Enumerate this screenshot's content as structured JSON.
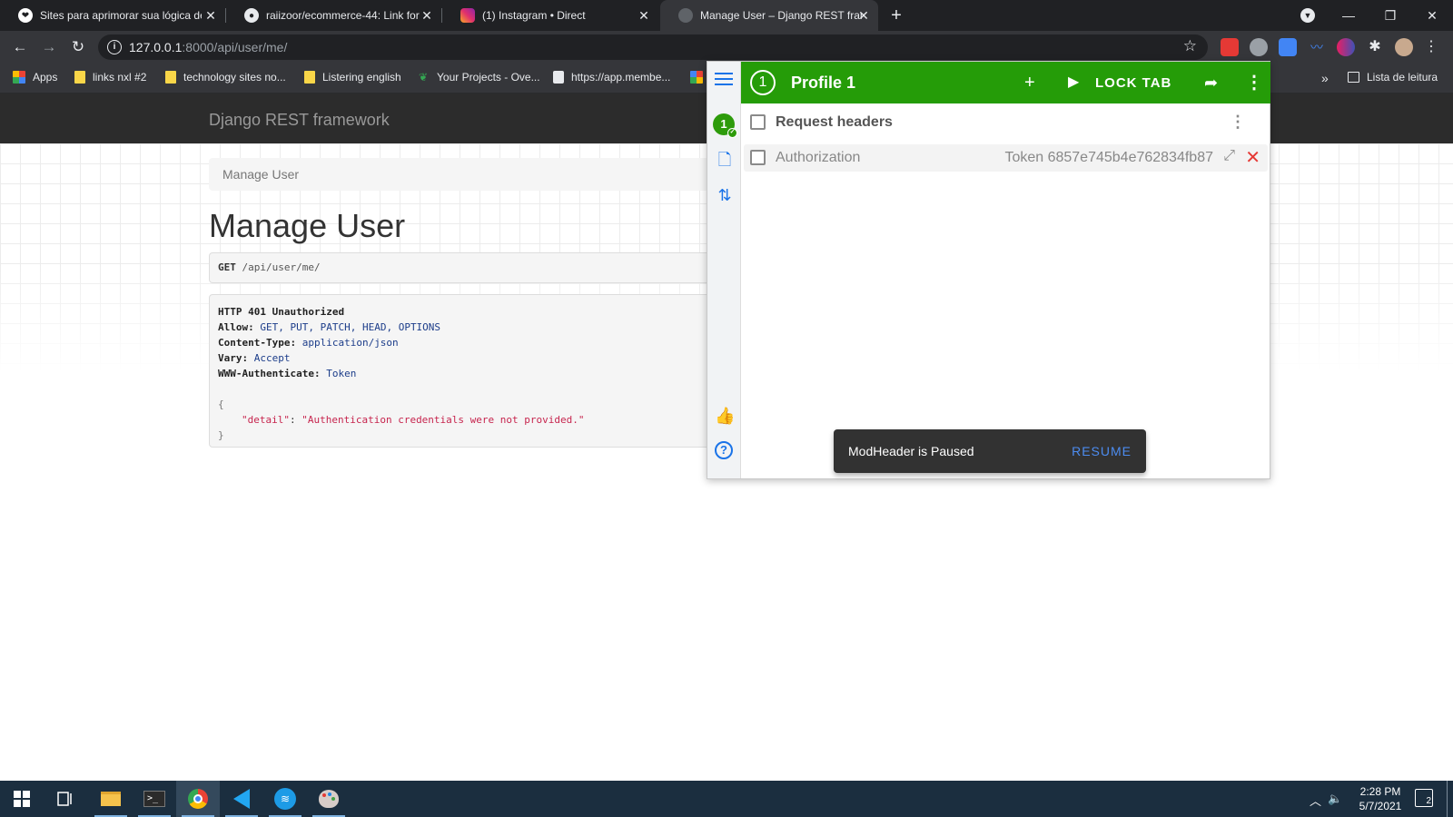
{
  "browser": {
    "tabs": [
      {
        "title": "Sites para aprimorar sua lógica de",
        "close": "✕"
      },
      {
        "title": "raiizoor/ecommerce-44: Link for",
        "close": "✕"
      },
      {
        "title": "(1) Instagram • Direct",
        "close": "✕"
      },
      {
        "title": "Manage User – Django REST fram",
        "close": "✕",
        "active": true
      }
    ],
    "new_tab": "+",
    "url_host": "127.0.0.1",
    "url_rest": ":8000/api/user/me/",
    "bookmarks": [
      {
        "label": "Apps"
      },
      {
        "label": "links nxl #2"
      },
      {
        "label": "technology sites no..."
      },
      {
        "label": "Listering english"
      },
      {
        "label": "Your Projects - Ove..."
      },
      {
        "label": "https://app.membe..."
      }
    ],
    "bookmarks_more": "»",
    "reading_list": "Lista de leitura"
  },
  "page": {
    "brand": "Django REST framework",
    "breadcrumb": "Manage User",
    "title": "Manage User",
    "request_method": "GET",
    "request_path": " /api/user/me/",
    "response": {
      "status": "HTTP 401 Unauthorized",
      "headers": [
        {
          "key": "Allow:",
          "value": "GET, PUT, PATCH, HEAD, OPTIONS"
        },
        {
          "key": "Content-Type:",
          "value": "application/json"
        },
        {
          "key": "Vary:",
          "value": "Accept"
        },
        {
          "key": "WWW-Authenticate:",
          "value": "Token"
        }
      ],
      "open_brace": "{",
      "body_key": "\"detail\"",
      "body_sep": ": ",
      "body_value": "\"Authentication credentials were not provided.\"",
      "close_brace": "}"
    }
  },
  "modheader": {
    "profile_number": "1",
    "profile_name": "Profile 1",
    "lock_tab": "LOCK TAB",
    "section_label": "Request headers",
    "header_name": "Authorization",
    "header_value": "Token 6857e745b4e762834fb87",
    "snackbar_message": "ModHeader is Paused",
    "snackbar_action": "RESUME",
    "accent_color": "#259c08"
  },
  "taskbar": {
    "time": "2:28 PM",
    "date": "5/7/2021",
    "notifications": "2"
  }
}
